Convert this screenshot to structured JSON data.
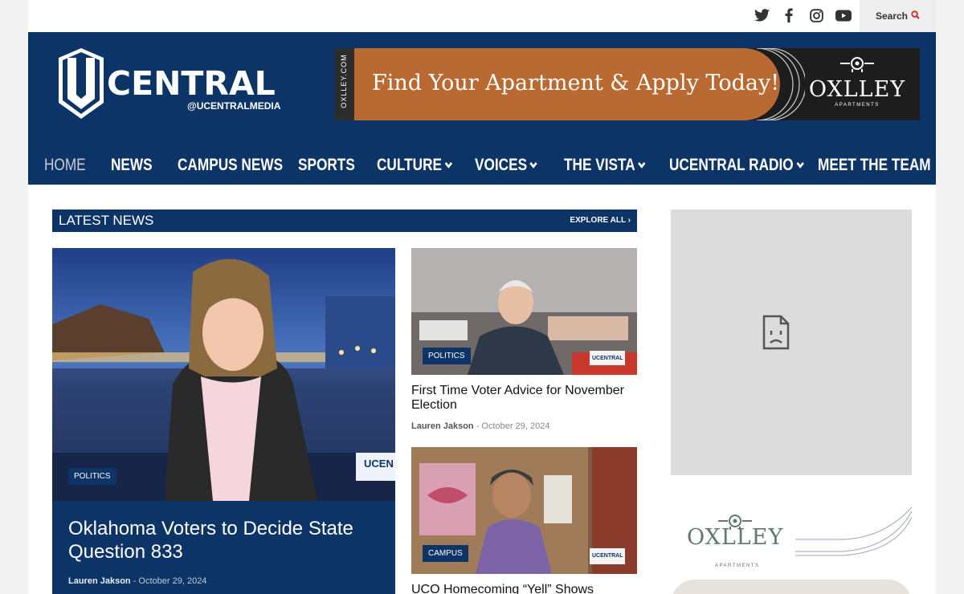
{
  "topbar": {
    "social": [
      "twitter-icon",
      "facebook-icon",
      "instagram-icon",
      "youtube-icon"
    ],
    "search_label": "Search"
  },
  "brand": {
    "logo_word": "CENTRAL",
    "logo_handle": "@UCENTRALMEDIA"
  },
  "ad_banner": {
    "side_text": "OXLLEY.COM",
    "headline": "Find Your Apartment & Apply Today!",
    "brand": "OXLLEY",
    "brand_sub": "APARTMENTS"
  },
  "nav": [
    {
      "label": "HOME",
      "active": true,
      "dropdown": false
    },
    {
      "label": "NEWS",
      "active": false,
      "dropdown": false
    },
    {
      "label": "CAMPUS NEWS",
      "active": false,
      "dropdown": false
    },
    {
      "label": "SPORTS",
      "active": false,
      "dropdown": false
    },
    {
      "label": "CULTURE",
      "active": false,
      "dropdown": true
    },
    {
      "label": "VOICES",
      "active": false,
      "dropdown": true
    },
    {
      "label": "THE VISTA",
      "active": false,
      "dropdown": true
    },
    {
      "label": "UCENTRAL RADIO",
      "active": false,
      "dropdown": true
    },
    {
      "label": "MEET THE TEAM",
      "active": false,
      "dropdown": false
    }
  ],
  "latest_news": {
    "title": "LATEST NEWS",
    "explore": "EXPLORE ALL"
  },
  "hero": {
    "category": "POLITICS",
    "title": "Oklahoma Voters to Decide State Question 833",
    "author": "Lauren Jakson",
    "date": "October 29, 2024"
  },
  "cards": [
    {
      "category": "POLITICS",
      "title": "First Time Voter Advice for November Election",
      "author": "Lauren Jakson",
      "date": "October 29, 2024"
    },
    {
      "category": "CAMPUS",
      "title": "UCO Homecoming “Yell” Shows",
      "author": "",
      "date": ""
    }
  ],
  "sidebar": {
    "ad2_brand": "OXLLEY",
    "ad2_sub": "APARTMENTS"
  },
  "colors": {
    "navy": "#0d3467",
    "ad_orange": "#b86a32",
    "sage": "#5d7a6a"
  }
}
